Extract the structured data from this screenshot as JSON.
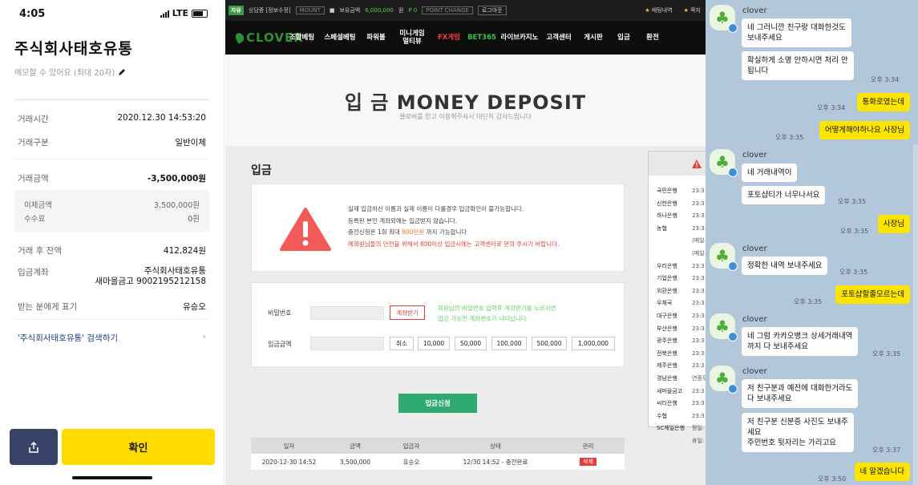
{
  "phone": {
    "time": "4:05",
    "network": "LTE",
    "account_name": "주식회사태호유통",
    "memo_placeholder": "메모할 수 있어요 (최대 20자)",
    "rows": [
      {
        "label": "거래시간",
        "value": "2020.12.30 14:53:20"
      },
      {
        "label": "거래구분",
        "value": "일반이체"
      },
      {
        "label": "거래금액",
        "value": "-3,500,000원"
      },
      {
        "label": "이체금액",
        "value": "3,500,000원"
      },
      {
        "label": "수수료",
        "value": "0원"
      },
      {
        "label": "거래 후 잔액",
        "value": "412,824원"
      },
      {
        "label": "입금계좌",
        "value_line1": "주식회사태호유통",
        "value_line2": "새마을금고 9002195212158"
      },
      {
        "label": "받는 분에게 표기",
        "value": "유승오"
      }
    ],
    "search_link": "'주식회사태호유통' 검색하기",
    "confirm_label": "확인"
  },
  "site": {
    "topbar": {
      "tag": "자유",
      "consult": "상담중 [정보수정]",
      "account_btn": "MOUNT",
      "holding_label": "보유금액",
      "holding_value": "6,000,000",
      "holding_unit": "원",
      "point": "P 0",
      "point_change": "POINT CHANGE",
      "logout": "로그아웃",
      "right1": "배팅내역",
      "right2": "쪽지"
    },
    "logo": "CLOVER",
    "nav": [
      "조합베팅",
      "스페셜베팅",
      "파워볼",
      "미니게임\n멀티뷰",
      "FX게임",
      "BET365",
      "라이브카지노",
      "고객센터",
      "게시판",
      "입금",
      "환전"
    ],
    "hero_title": "입 금 MONEY DEPOSIT",
    "hero_sub": "클로버를 믿고 이용해주셔서 대단히 감사드립니다",
    "section_title": "입금",
    "notice": {
      "line1": "실제 입금하신 이름과 실제 이름이 다를경우 입금확인이 불가능합니다.",
      "line2": "등록된 본인 계좌외에는 입금받지 않습니다.",
      "line3_a": "충전신청은 1회 최대 ",
      "line3_b": "800만원",
      "line3_c": " 까지 가능합니다",
      "line4": "예회원님들의 안전을 위해서 800이상 입금시에는 고객센터로 문의 주시기 바랍니다."
    },
    "form": {
      "pw_label": "비밀번호",
      "acct_btn": "계좌받기",
      "hint1": "회원님의 비밀번호 입력후 계좌받기를 누르시면",
      "hint2": "입금 가능한 계좌번호가 나타납니다.",
      "amount_label": "입금금액",
      "amount_btns": [
        "취소",
        "10,000",
        "50,000",
        "100,000",
        "500,000",
        "1,000,000"
      ]
    },
    "submit": "입금신청",
    "table": {
      "headers": [
        "일자",
        "금액",
        "입금자",
        "상태",
        "관리"
      ],
      "rows": [
        {
          "date": "2020-12-30 14:52",
          "amount": "3,500,000",
          "depositor": "유승오",
          "status": "12/30 14:52 - 충전완료",
          "action": "삭제"
        }
      ]
    },
    "banks": [
      {
        "name": "국민은행",
        "time": "23:3"
      },
      {
        "name": "신한은행",
        "time": "23:3"
      },
      {
        "name": "하나은행",
        "time": "23:3"
      },
      {
        "name": "농협",
        "time": "23:3"
      },
      {
        "name": "",
        "time": "(매일"
      },
      {
        "name": "",
        "time": "(매일"
      },
      {
        "name": "우리은행",
        "time": "23:3"
      },
      {
        "name": "기업은행",
        "time": "23:3"
      },
      {
        "name": "외환은행",
        "time": "23:3"
      },
      {
        "name": "우체국",
        "time": "23:3"
      },
      {
        "name": "대구은행",
        "time": "23:3"
      },
      {
        "name": "부산은행",
        "time": "23:3"
      },
      {
        "name": "광주은행",
        "time": "23:3"
      },
      {
        "name": "전북은행",
        "time": "23:3"
      },
      {
        "name": "제주은행",
        "time": "23:3"
      },
      {
        "name": "경남은행",
        "time": "연중무"
      },
      {
        "name": "새마을금고",
        "time": "23:3"
      },
      {
        "name": "씨티은행",
        "time": "23:3"
      },
      {
        "name": "수협",
        "time": "23:3"
      },
      {
        "name": "SC제일은행",
        "time": "평일:"
      },
      {
        "name": "",
        "time": "휴일:"
      }
    ]
  },
  "chat": {
    "sender_name": "clover",
    "messages": {
      "m1": "네 그러니깐 친구랑 대화한것도\n보내주세요",
      "m2": "확실하게 소명 안하시면 처리 안\n됩니다",
      "t2": "오후 3:34",
      "m3": "통화로였는데",
      "t3": "오후 3:34",
      "m4": "어떻게해야하나요 사장님",
      "t4": "오후 3:35",
      "m5": "네 거래내역이",
      "m6": "포토샵티가 너무나서요",
      "t6": "오후 3:35",
      "m7": "사장님",
      "t7": "오후 3:35",
      "m8": "정확한 내역 보내주세요",
      "t8": "오후 3:35",
      "m9": "포토샵할줄모르는데",
      "t9": "오후 3:35",
      "m10": "네 그럼 카카오뱅크 상세거래내역\n까지 다 보내주세요",
      "t10": "오후 3:35",
      "m11": "저 친구분과 예전에 대화한거라도\n 다 보내주세요",
      "m12": "저 친구분 신분증 사진도 보내주\n세요\n주민번호 뒷자리는 가리고요",
      "t12": "오후 3:37",
      "m13": "네 알겠습니다",
      "t13": "오후 3:50"
    }
  },
  "colors": {
    "kakao_yellow": "#fee500",
    "chat_bg": "#b2c7d9",
    "confirm_yellow": "#ffdb00",
    "site_green": "#2fa972",
    "alert_red": "#e53c3c"
  }
}
